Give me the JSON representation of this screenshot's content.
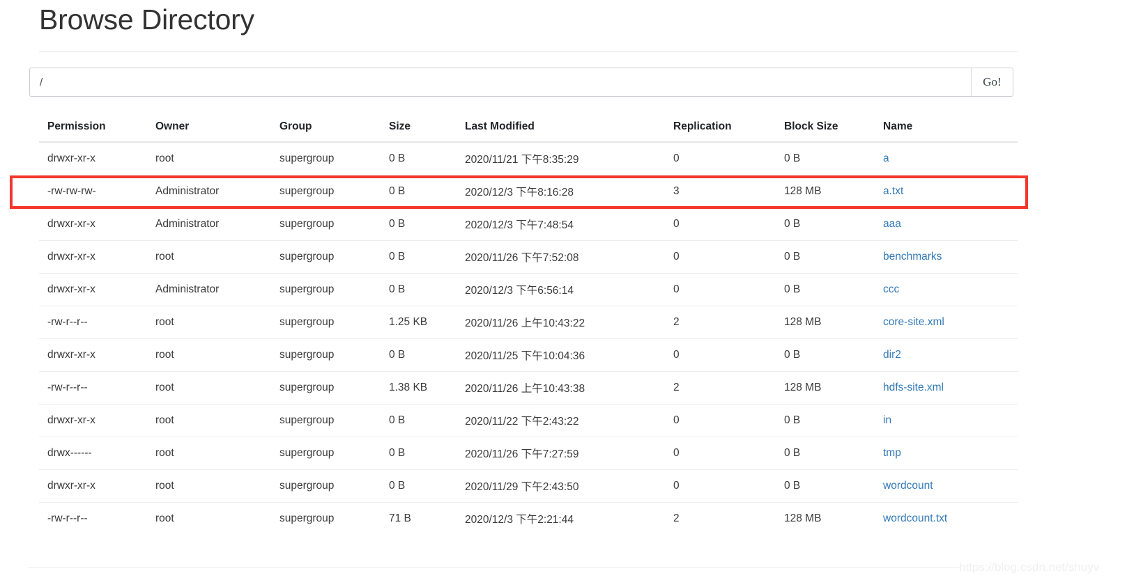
{
  "page": {
    "title": "Browse Directory",
    "watermark": "https://blog.csdn.net/shuyv"
  },
  "path_bar": {
    "value": "/",
    "placeholder": "/",
    "go_label": "Go!"
  },
  "colors": {
    "link": "#337ab7",
    "highlight_border": "#f4372c",
    "text": "#333333",
    "header_text": "#212529",
    "row_divider": "#eceded"
  },
  "table": {
    "columns": [
      "Permission",
      "Owner",
      "Group",
      "Size",
      "Last Modified",
      "Replication",
      "Block Size",
      "Name"
    ],
    "highlighted_row_index": 1,
    "rows": [
      {
        "permission": "drwxr-xr-x",
        "owner": "root",
        "group": "supergroup",
        "size": "0 B",
        "last_modified": "2020/11/21 下午8:35:29",
        "replication": "0",
        "block_size": "0 B",
        "name": "a"
      },
      {
        "permission": "-rw-rw-rw-",
        "owner": "Administrator",
        "group": "supergroup",
        "size": "0 B",
        "last_modified": "2020/12/3 下午8:16:28",
        "replication": "3",
        "block_size": "128 MB",
        "name": "a.txt"
      },
      {
        "permission": "drwxr-xr-x",
        "owner": "Administrator",
        "group": "supergroup",
        "size": "0 B",
        "last_modified": "2020/12/3 下午7:48:54",
        "replication": "0",
        "block_size": "0 B",
        "name": "aaa"
      },
      {
        "permission": "drwxr-xr-x",
        "owner": "root",
        "group": "supergroup",
        "size": "0 B",
        "last_modified": "2020/11/26 下午7:52:08",
        "replication": "0",
        "block_size": "0 B",
        "name": "benchmarks"
      },
      {
        "permission": "drwxr-xr-x",
        "owner": "Administrator",
        "group": "supergroup",
        "size": "0 B",
        "last_modified": "2020/12/3 下午6:56:14",
        "replication": "0",
        "block_size": "0 B",
        "name": "ccc"
      },
      {
        "permission": "-rw-r--r--",
        "owner": "root",
        "group": "supergroup",
        "size": "1.25 KB",
        "last_modified": "2020/11/26 上午10:43:22",
        "replication": "2",
        "block_size": "128 MB",
        "name": "core-site.xml"
      },
      {
        "permission": "drwxr-xr-x",
        "owner": "root",
        "group": "supergroup",
        "size": "0 B",
        "last_modified": "2020/11/25 下午10:04:36",
        "replication": "0",
        "block_size": "0 B",
        "name": "dir2"
      },
      {
        "permission": "-rw-r--r--",
        "owner": "root",
        "group": "supergroup",
        "size": "1.38 KB",
        "last_modified": "2020/11/26 上午10:43:38",
        "replication": "2",
        "block_size": "128 MB",
        "name": "hdfs-site.xml"
      },
      {
        "permission": "drwxr-xr-x",
        "owner": "root",
        "group": "supergroup",
        "size": "0 B",
        "last_modified": "2020/11/22 下午2:43:22",
        "replication": "0",
        "block_size": "0 B",
        "name": "in"
      },
      {
        "permission": "drwx------",
        "owner": "root",
        "group": "supergroup",
        "size": "0 B",
        "last_modified": "2020/11/26 下午7:27:59",
        "replication": "0",
        "block_size": "0 B",
        "name": "tmp"
      },
      {
        "permission": "drwxr-xr-x",
        "owner": "root",
        "group": "supergroup",
        "size": "0 B",
        "last_modified": "2020/11/29 下午2:43:50",
        "replication": "0",
        "block_size": "0 B",
        "name": "wordcount"
      },
      {
        "permission": "-rw-r--r--",
        "owner": "root",
        "group": "supergroup",
        "size": "71 B",
        "last_modified": "2020/12/3 下午2:21:44",
        "replication": "2",
        "block_size": "128 MB",
        "name": "wordcount.txt"
      }
    ]
  }
}
